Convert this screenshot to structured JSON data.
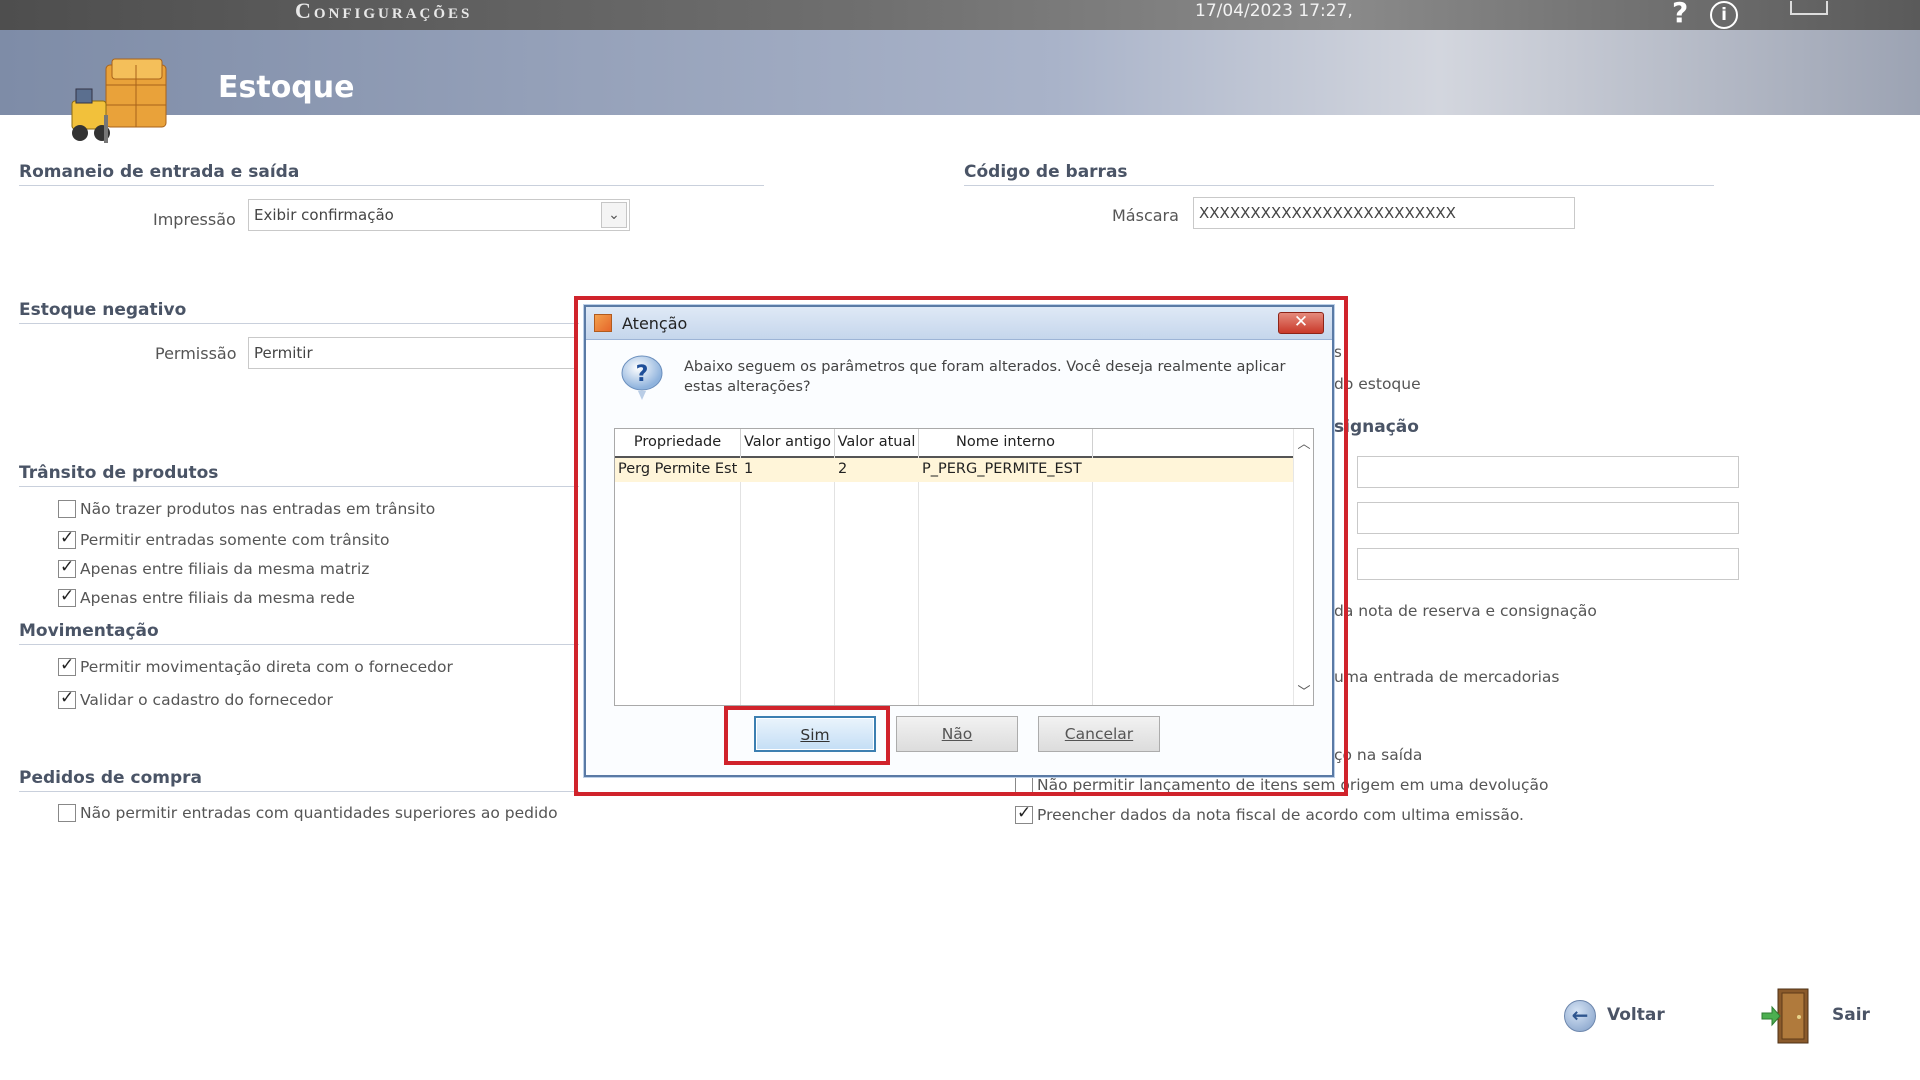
{
  "topbar": {
    "app_title": "Configurações",
    "datetime": "17/04/2023 17:27,",
    "help_glyph": "?",
    "info_glyph": "i"
  },
  "header": {
    "title": "Estoque"
  },
  "romaneio": {
    "heading": "Romaneio de entrada e saída",
    "impressao_label": "Impressão",
    "impressao_value": "Exibir confirmação"
  },
  "codigo_barras": {
    "heading": "Código de barras",
    "mascara_label": "Máscara",
    "mascara_value": "XXXXXXXXXXXXXXXXXXXXXXXXX"
  },
  "estoque_negativo": {
    "heading": "Estoque negativo",
    "permissao_label": "Permissão",
    "permissao_value": "Permitir"
  },
  "transito": {
    "heading": "Trânsito de produtos",
    "items": [
      {
        "label": "Não trazer produtos nas entradas em trânsito",
        "checked": false
      },
      {
        "label": "Permitir entradas somente com trânsito",
        "checked": true
      },
      {
        "label": "Apenas entre filiais da mesma matriz",
        "checked": true
      },
      {
        "label": "Apenas entre filiais da mesma rede",
        "checked": true
      }
    ]
  },
  "movimentacao": {
    "heading": "Movimentação",
    "items": [
      {
        "label": "Permitir movimentação direta com o fornecedor",
        "checked": true
      },
      {
        "label": "Validar o cadastro do fornecedor",
        "checked": true
      }
    ]
  },
  "pedidos": {
    "heading": "Pedidos de compra",
    "items": [
      {
        "label": "Não permitir entradas com quantidades superiores ao pedido",
        "checked": false
      }
    ]
  },
  "right_partial": {
    "text_s": "s",
    "text_estoque": "do estoque",
    "heading_signacao": "signação",
    "text_reserva": "da nota de reserva e consignação",
    "text_entrada": "uma entrada de mercadorias",
    "text_saida": "ço na saída",
    "items": [
      {
        "label": "Não permitir lançamento de itens sem origem em uma devolução",
        "checked": false
      },
      {
        "label": "Preencher dados da nota fiscal de acordo com ultima emissão.",
        "checked": true
      }
    ]
  },
  "dialog": {
    "title": "Atenção",
    "close_glyph": "✕",
    "message": "Abaixo seguem os parâmetros que foram alterados. Você deseja realmente aplicar estas alterações?",
    "columns": [
      "Propriedade",
      "Valor antigo",
      "Valor atual",
      "Nome interno"
    ],
    "rows": [
      [
        "Perg Permite Est",
        "1",
        "2",
        "P_PERG_PERMITE_EST"
      ]
    ],
    "buttons": {
      "yes": "Sim",
      "no": "Não",
      "cancel": "Cancelar"
    }
  },
  "footer": {
    "back": "Voltar",
    "exit": "Sair"
  },
  "colors": {
    "highlight": "#d0232b",
    "row_selected": "#fff5d9",
    "heading": "#4a5466"
  }
}
